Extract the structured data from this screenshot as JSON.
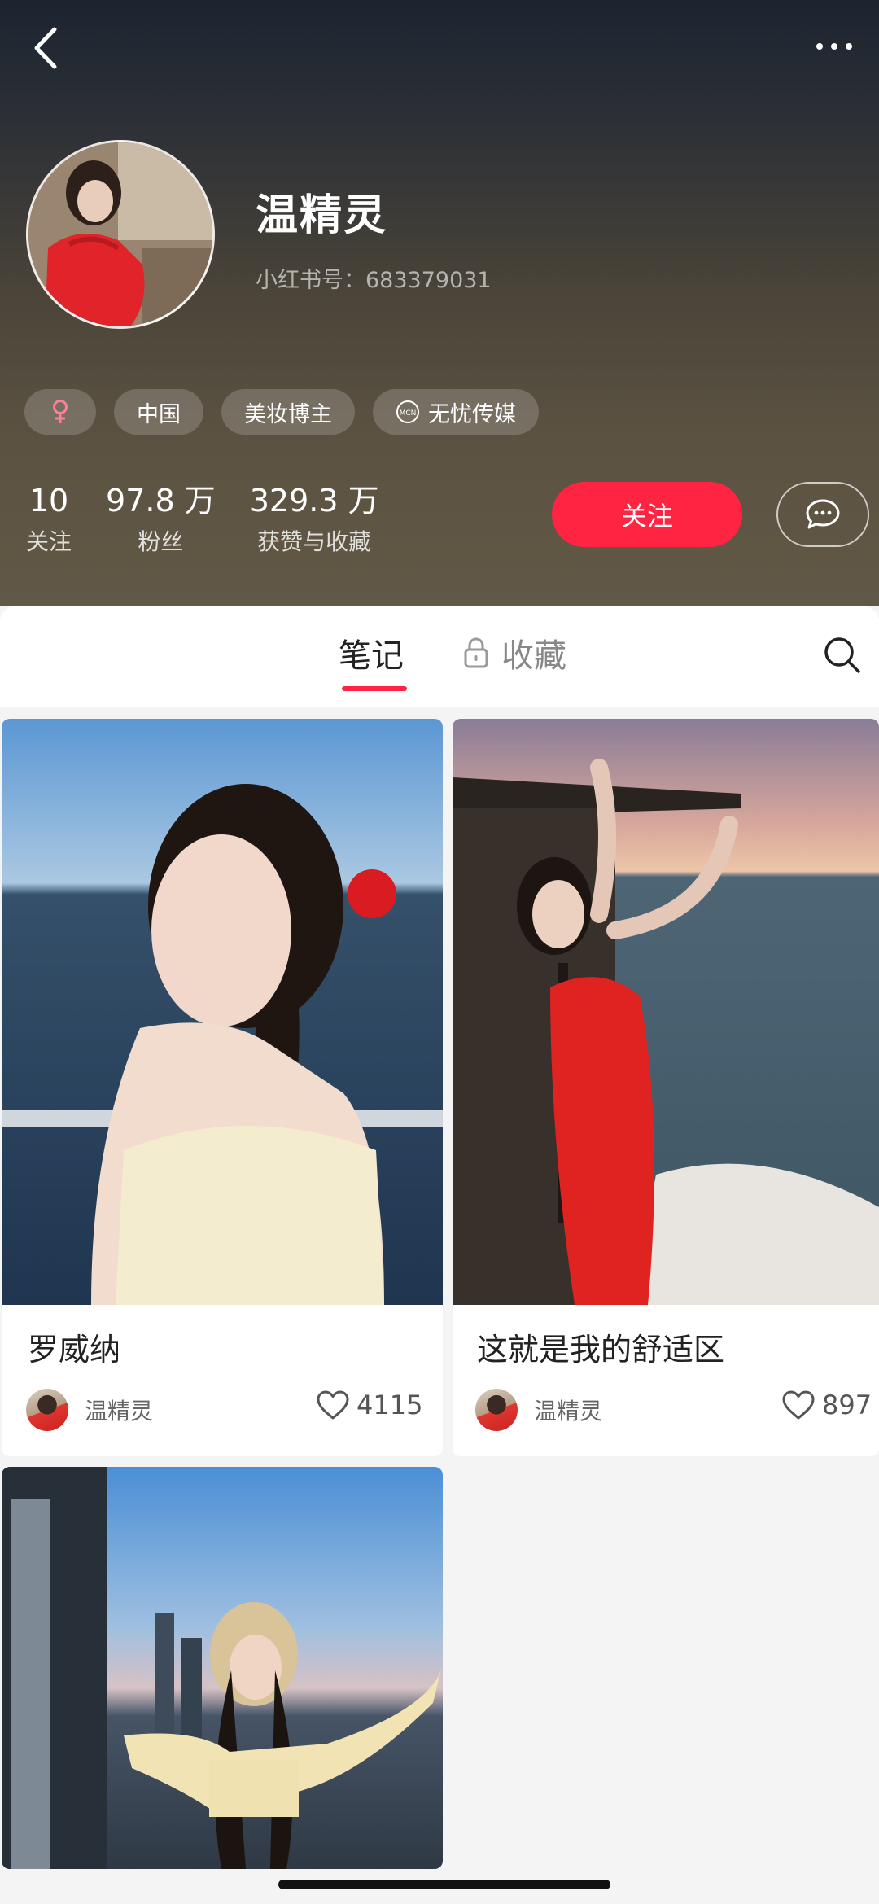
{
  "profile": {
    "nickname": "温精灵",
    "id_text": "小红书号：683379031",
    "tags": [
      {
        "label": "",
        "icon": "female-icon"
      },
      {
        "label": "中国"
      },
      {
        "label": "美妆博主"
      },
      {
        "label": "无忧传媒",
        "icon": "mcn-icon"
      }
    ],
    "stats": [
      {
        "value": "10",
        "label": "关注"
      },
      {
        "value": "97.8 万",
        "label": "粉丝"
      },
      {
        "value": "329.3 万",
        "label": "获赞与收藏"
      }
    ],
    "follow_label": "关注"
  },
  "tabs": [
    {
      "label": "笔记",
      "active": true
    },
    {
      "label": "收藏",
      "locked": true
    }
  ],
  "notes": [
    {
      "title": "罗威纳",
      "author": "温精灵",
      "likes": "4115"
    },
    {
      "title": "这就是我的舒适区",
      "author": "温精灵",
      "likes": "897"
    },
    {
      "title": "",
      "author": "",
      "likes": ""
    }
  ],
  "colors": {
    "accent": "#ff2442",
    "header_top": "#1c2430",
    "header_bottom": "#615846"
  }
}
